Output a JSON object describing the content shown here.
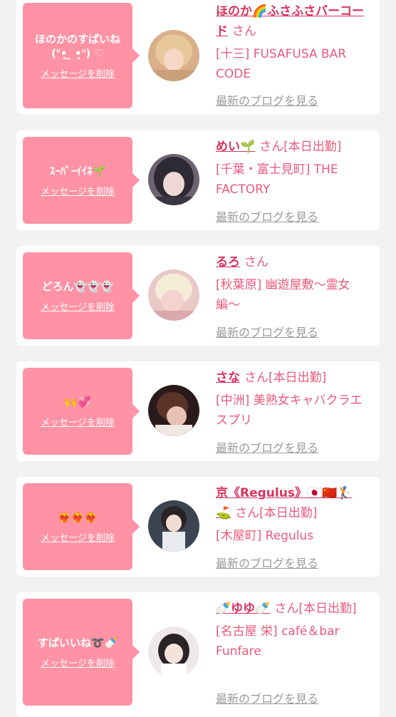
{
  "entries": [
    {
      "message": "ほのかのすぱいね\n (ᐡ•̥ ̫ •̥ᐡ) ♡",
      "delete_label": "メッセージを削除",
      "name": "ほのか🌈ふさふさバーコード",
      "honorific": "さん",
      "status": "",
      "shop": "[十三] FUSAFUSA BAR CODE",
      "blog_label": "最新のブログを見る"
    },
    {
      "message": "ｽｰﾊﾟｰｲｲﾈ🌱",
      "delete_label": "メッセージを削除",
      "name": "めい🌱",
      "honorific": "さん",
      "status": "[本日出勤]",
      "shop": "[千葉・富士見町] THE FACTORY",
      "blog_label": "最新のブログを見る"
    },
    {
      "message": "どろん👻👻👻",
      "delete_label": "メッセージを削除",
      "name": "るろ",
      "honorific": "さん",
      "status": "",
      "shop": "[秋葉原] 幽遊屋敷〜霊女編〜",
      "blog_label": "最新のブログを見る"
    },
    {
      "message": "🙌💞",
      "delete_label": "メッセージを削除",
      "name": "さな",
      "honorific": "さん",
      "status": "[本日出勤]",
      "shop": "[中洲] 美熟女キャバクラエスプリ",
      "blog_label": "最新のブログを見る"
    },
    {
      "message": "❤️‍🔥❤️‍🔥❤️‍🔥",
      "delete_label": "メッセージを削除",
      "name": "京《Regulus》🇯🇵🇨🇳🏌️⛳",
      "honorific": "さん",
      "status": "[本日出勤]",
      "shop": "[木屋町] Regulus",
      "blog_label": "最新のブログを見る"
    },
    {
      "message": "すぱいいね➰🍼",
      "delete_label": "メッセージを削除",
      "name": "🍼ゆゆ🍼",
      "honorific": "さん",
      "status": "[本日出勤]",
      "shop": "[名古屋 栄] café＆bar Funfare",
      "blog_label": "最新のブログを見る"
    }
  ],
  "colors": {
    "bubble": "#ff92a4",
    "name": "#d8345f",
    "text": "#e85a7c",
    "link_gray": "#9a9a9a"
  }
}
